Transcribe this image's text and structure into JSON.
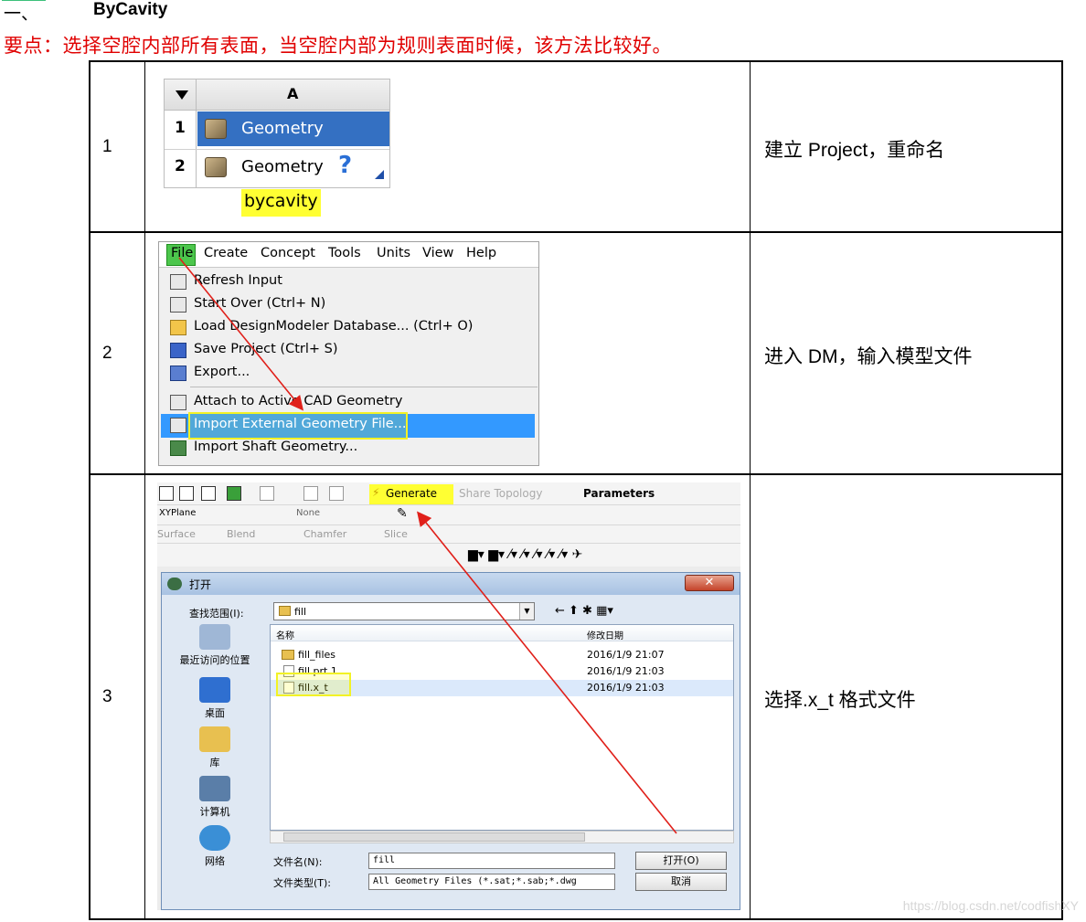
{
  "section": {
    "number": "一、",
    "title": "ByCavity"
  },
  "note": "要点：选择空腔内部所有表面，当空腔内部为规则表面时候，该方法比较好。",
  "steps": [
    {
      "num": "1",
      "desc": "建立 Project，重命名"
    },
    {
      "num": "2",
      "desc": "进入 DM，输入模型文件"
    },
    {
      "num": "3",
      "desc": "选择.x_t 格式文件"
    }
  ],
  "step1": {
    "column": "A",
    "rows": [
      {
        "n": "1",
        "label": "Geometry"
      },
      {
        "n": "2",
        "label": "Geometry"
      }
    ],
    "rename": "bycavity"
  },
  "step2": {
    "menubar": [
      "File",
      "Create",
      "Concept",
      "Tools",
      "Units",
      "View",
      "Help"
    ],
    "items": [
      "Refresh Input",
      "Start Over (Ctrl+ N)",
      "Load DesignModeler Database... (Ctrl+ O)",
      "Save Project (Ctrl+ S)",
      "Export...",
      "Attach to Active CAD Geometry",
      "Import External Geometry File...",
      "Import Shaft Geometry..."
    ]
  },
  "step3": {
    "generate": "Generate",
    "share_topology": "Share Topology",
    "parameters": "Parameters",
    "plane": "XYPlane",
    "none": "None",
    "toolbar3": [
      "Surface",
      "Blend",
      "Chamfer",
      "Slice"
    ],
    "dialog_title": "打开",
    "look_in_label": "查找范围(I):",
    "look_in_value": "fill",
    "col_name": "名称",
    "col_date": "修改日期",
    "files": [
      {
        "name": "fill_files",
        "date": "2016/1/9 21:07",
        "kind": "folder"
      },
      {
        "name": "fill.prt.1",
        "date": "2016/1/9 21:03",
        "kind": "file"
      },
      {
        "name": "fill.x_t",
        "date": "2016/1/9 21:03",
        "kind": "file"
      }
    ],
    "places": [
      "最近访问的位置",
      "桌面",
      "库",
      "计算机",
      "网络"
    ],
    "filename_label": "文件名(N):",
    "filename_value": "fill",
    "filetype_label": "文件类型(T):",
    "filetype_value": "All Geometry Files (*.sat;*.sab;*.dwg",
    "open_btn": "打开(O)",
    "cancel_btn": "取消"
  },
  "watermark": "https://blog.csdn.net/codfishXY"
}
